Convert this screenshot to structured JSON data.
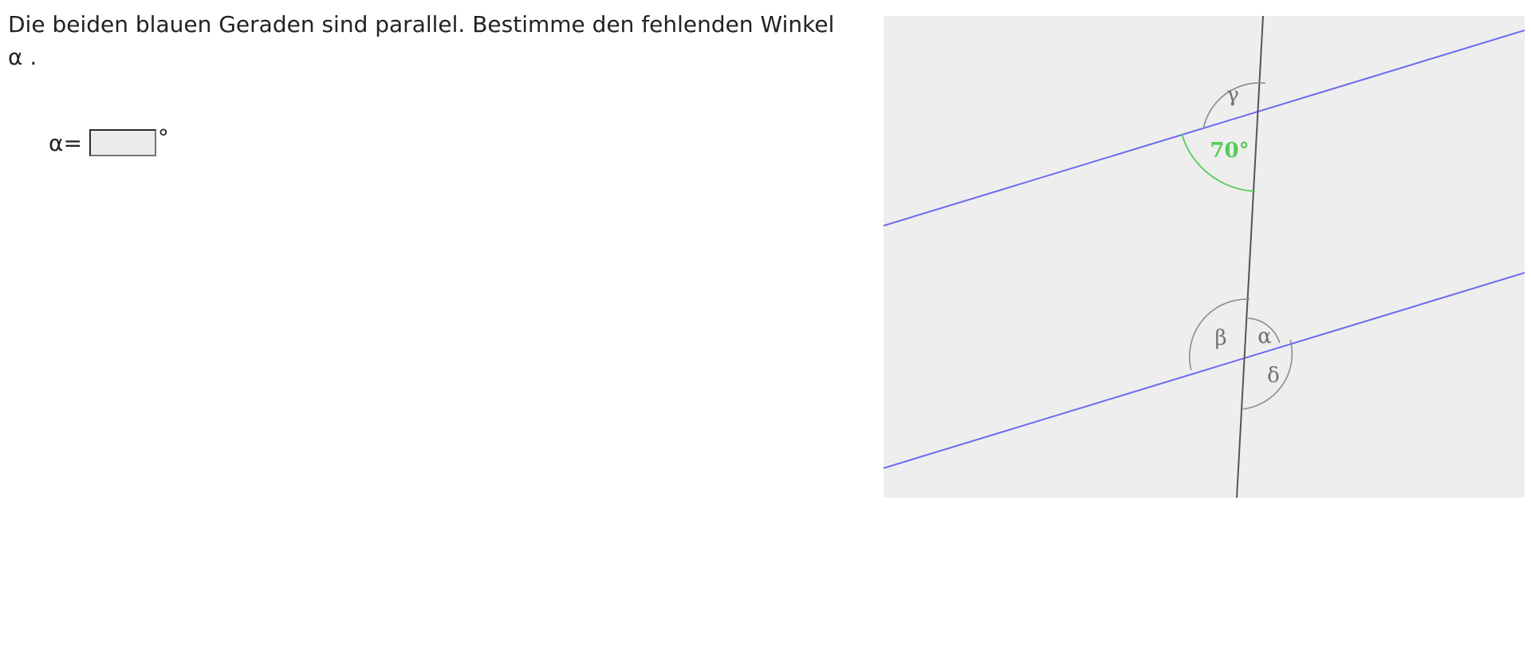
{
  "task": {
    "text": "Die beiden blauen Geraden sind parallel. Bestimme den fehlenden Winkel",
    "variable": "α",
    "end": " ."
  },
  "answer": {
    "label": "α=",
    "value": "",
    "unit": "°"
  },
  "diagram": {
    "line_color": "#6b6bf0",
    "transversal_color": "#555555",
    "arc_color": "#8c8c8c",
    "given_color": "#55cc55",
    "given_angle": "70°",
    "angle_labels": {
      "gamma": "γ",
      "beta": "β",
      "alpha": "α",
      "delta": "δ"
    }
  }
}
